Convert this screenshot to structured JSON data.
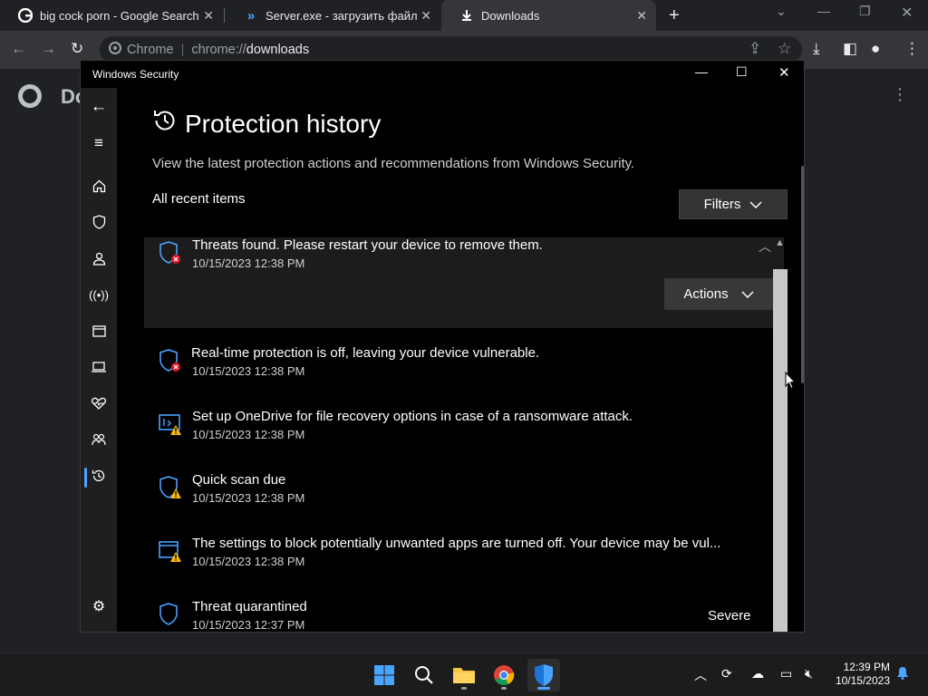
{
  "chrome": {
    "tabs": [
      {
        "title": "big cock porn - Google Search",
        "favicon": "google-icon"
      },
      {
        "title": "Server.exe - загрузить файл",
        "favicon": "virustotal-icon"
      },
      {
        "title": "Downloads",
        "favicon": "download-icon"
      }
    ],
    "omnibox": {
      "chip": "Chrome",
      "url_scheme": "chrome://",
      "url_host": "downloads"
    },
    "page_title": "Do"
  },
  "window": {
    "title": "Windows Security"
  },
  "main": {
    "title": "Protection history",
    "subtitle": "View the latest protection actions and recommendations from Windows Security.",
    "section_label": "All recent items",
    "filters_label": "Filters",
    "actions_label": "Actions",
    "items": [
      {
        "message": "Threats found. Please restart your device to remove them.",
        "date": "10/15/2023 12:38 PM",
        "badge": "error"
      },
      {
        "message": "Real-time protection is off, leaving your device vulnerable.",
        "date": "10/15/2023 12:38 PM",
        "badge": "error"
      },
      {
        "message": "Set up OneDrive for file recovery options in case of a ransomware attack.",
        "date": "10/15/2023 12:38 PM",
        "badge": "warning"
      },
      {
        "message": "Quick scan due",
        "date": "10/15/2023 12:38 PM",
        "badge": "warning"
      },
      {
        "message": "The settings to block potentially unwanted apps are turned off. Your device may be vul...",
        "date": "10/15/2023 12:38 PM",
        "badge": "warning"
      },
      {
        "message": "Threat quarantined",
        "date": "10/15/2023 12:37 PM",
        "badge": "none",
        "severity": "Severe"
      }
    ]
  },
  "taskbar": {
    "clock_time": "12:39 PM",
    "clock_date": "10/15/2023"
  },
  "colors": {
    "accent": "#4aa3ff",
    "error": "#e81123",
    "warning": "#ffb900"
  }
}
